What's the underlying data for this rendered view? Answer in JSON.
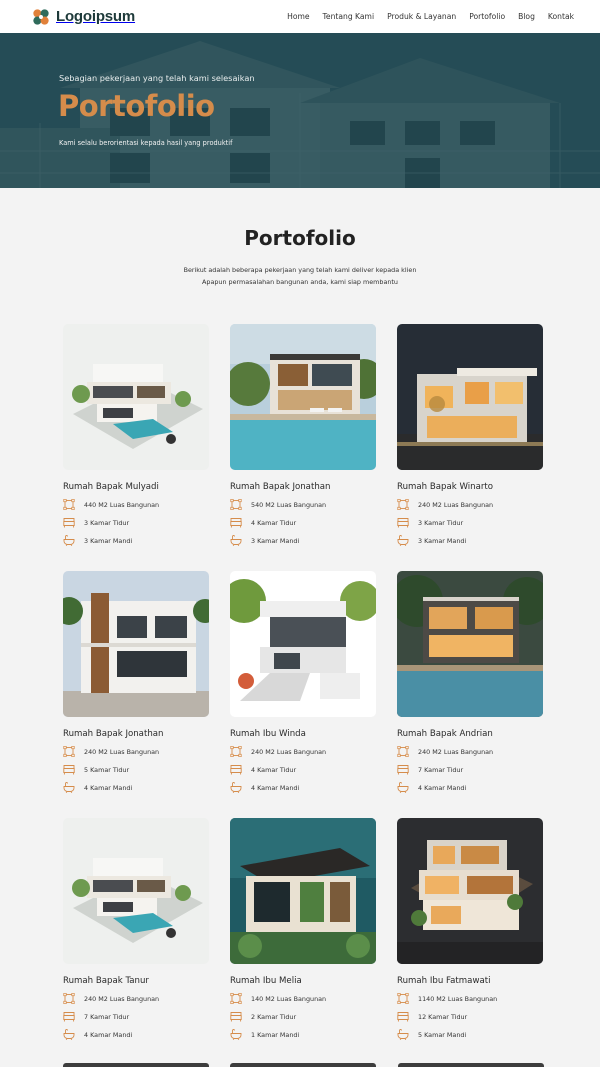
{
  "brand": {
    "name": "Logoipsum"
  },
  "nav": [
    {
      "label": "Home"
    },
    {
      "label": "Tentang Kami"
    },
    {
      "label": "Produk & Layanan"
    },
    {
      "label": "Portofolio"
    },
    {
      "label": "Blog"
    },
    {
      "label": "Kontak"
    }
  ],
  "hero": {
    "eyebrow": "Sebagian pekerjaan yang telah kami selesaikan",
    "title": "Portofolio",
    "subtitle": "Kami selalu berorientasi kepada hasil yang produktif"
  },
  "section": {
    "title": "Portofolio",
    "desc_line1": "Berikut adalah beberapa pekerjaan yang telah kami deliver kepada klien",
    "desc_line2": "Apapun permasalahan bangunan anda, kami siap membantu"
  },
  "colors": {
    "accent": "#d58c4b",
    "hero_overlay": "#1b444e",
    "background": "#f3f3f3"
  },
  "projects": [
    {
      "name": "Rumah Bapak Mulyadi",
      "area": "440 M2 Luas Bangunan",
      "bedrooms": "3 Kamar Tidur",
      "bathrooms": "3 Kamar Mandi"
    },
    {
      "name": "Rumah Bapak Jonathan",
      "area": "540 M2 Luas Bangunan",
      "bedrooms": "4 Kamar Tidur",
      "bathrooms": "3 Kamar Mandi"
    },
    {
      "name": "Rumah Bapak Winarto",
      "area": "240 M2 Luas Bangunan",
      "bedrooms": "3 Kamar Tidur",
      "bathrooms": "3 Kamar Mandi"
    },
    {
      "name": "Rumah Bapak Jonathan",
      "area": "240 M2 Luas Bangunan",
      "bedrooms": "5 Kamar Tidur",
      "bathrooms": "4 Kamar Mandi"
    },
    {
      "name": "Rumah Ibu Winda",
      "area": "240 M2 Luas Bangunan",
      "bedrooms": "4 Kamar Tidur",
      "bathrooms": "4 Kamar Mandi"
    },
    {
      "name": "Rumah Bapak Andrian",
      "area": "240 M2 Luas Bangunan",
      "bedrooms": "7 Kamar Tidur",
      "bathrooms": "4 Kamar Mandi"
    },
    {
      "name": "Rumah Bapak Tanur",
      "area": "240 M2 Luas Bangunan",
      "bedrooms": "7 Kamar Tidur",
      "bathrooms": "4 Kamar Mandi"
    },
    {
      "name": "Rumah Ibu Melia",
      "area": "140 M2 Luas Bangunan",
      "bedrooms": "2 Kamar Tidur",
      "bathrooms": "1 Kamar Mandi"
    },
    {
      "name": "Rumah Ibu Fatmawati",
      "area": "1140 M2 Luas Bangunan",
      "bedrooms": "12 Kamar Tidur",
      "bathrooms": "5 Kamar Mandi"
    }
  ],
  "icons": {
    "area": "area-icon",
    "bed": "bed-icon",
    "bath": "bathtub-icon"
  }
}
